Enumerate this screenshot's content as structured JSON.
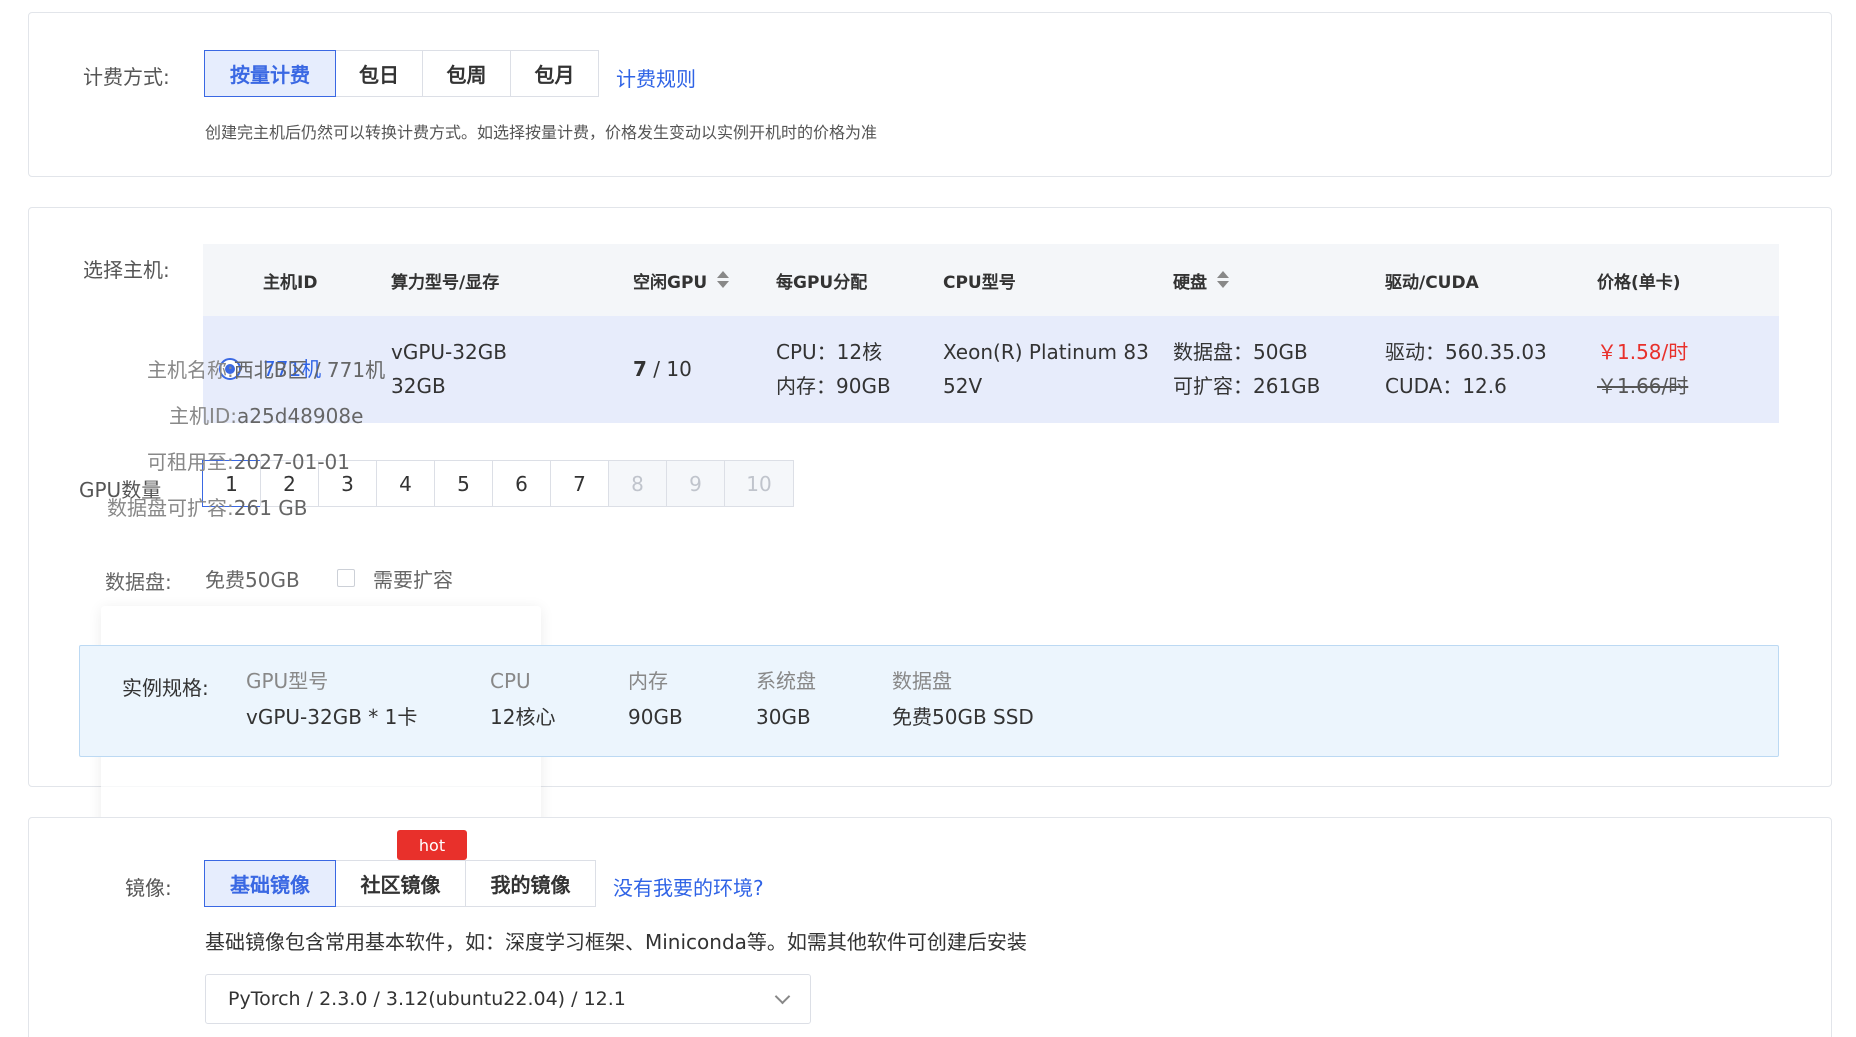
{
  "billing": {
    "label": "计费方式:",
    "options": [
      "按量计费",
      "包日",
      "包周",
      "包月"
    ],
    "rules_link": "计费规则",
    "tip": "创建完主机后仍然可以转换计费方式。如选择按量计费，价格发生变动以实例开机时的价格为准"
  },
  "host": {
    "label": "选择主机:",
    "headers": {
      "id": "主机ID",
      "model": "算力型号/显存",
      "free_gpu": "空闲GPU",
      "per_gpu": "每GPU分配",
      "cpu_model": "CPU型号",
      "disk": "硬盘",
      "driver": "驱动/CUDA",
      "price": "价格(单卡)"
    },
    "row": {
      "id": "771机",
      "model_line1": "vGPU-32GB",
      "model_line2": "32GB",
      "free_gpu_num": "7",
      "free_gpu_total": " / 10",
      "cpu_alloc": "CPU：12核",
      "mem_alloc": "内存：90GB",
      "cpu_model_line1": "Xeon(R) Platinum 83",
      "cpu_model_line2": "52V",
      "disk_data": "数据盘：50GB",
      "disk_expand": "可扩容：261GB",
      "driver": "驱动：560.35.03",
      "cuda": "CUDA：12.6",
      "price_now": "￥1.58/时",
      "price_old": "￥1.66/时"
    },
    "tooltip": {
      "name_k": "主机名称:",
      "name_v": "西北B区 / 771机",
      "id_k": "主机ID:",
      "id_v": "a25d48908e",
      "until_k": "可租用至:",
      "until_v": "2027-01-01",
      "expand_k": "数据盘可扩容:",
      "expand_v": "261 GB"
    },
    "gpu_count_label": "GPU数量",
    "gpu_counts": [
      "1",
      "2",
      "3",
      "4",
      "5",
      "6",
      "7",
      "8",
      "9",
      "10"
    ],
    "datadisk_label": "数据盘:",
    "datadisk_free": "免费50GB",
    "datadisk_expand_check": "需要扩容"
  },
  "spec": {
    "label": "实例规格:",
    "cols": [
      {
        "k": "GPU型号",
        "v": "vGPU-32GB * 1卡"
      },
      {
        "k": "CPU",
        "v": "12核心"
      },
      {
        "k": "内存",
        "v": "90GB"
      },
      {
        "k": "系统盘",
        "v": "30GB"
      },
      {
        "k": "数据盘",
        "v": "免费50GB SSD"
      }
    ]
  },
  "image": {
    "label": "镜像:",
    "tabs": [
      "基础镜像",
      "社区镜像",
      "我的镜像"
    ],
    "hot": "hot",
    "missing_link": "没有我要的环境?",
    "desc": "基础镜像包含常用基本软件，如：深度学习框架、Miniconda等。如需其他软件可创建后安装",
    "selected": "PyTorch / 2.3.0 / 3.12(ubuntu22.04) / 12.1"
  },
  "colors": {
    "accent": "#3a68e3",
    "link": "#2f63e6",
    "price": "#e8302b",
    "hot": "#e8302b",
    "spec_bg": "#ecf5fd"
  }
}
